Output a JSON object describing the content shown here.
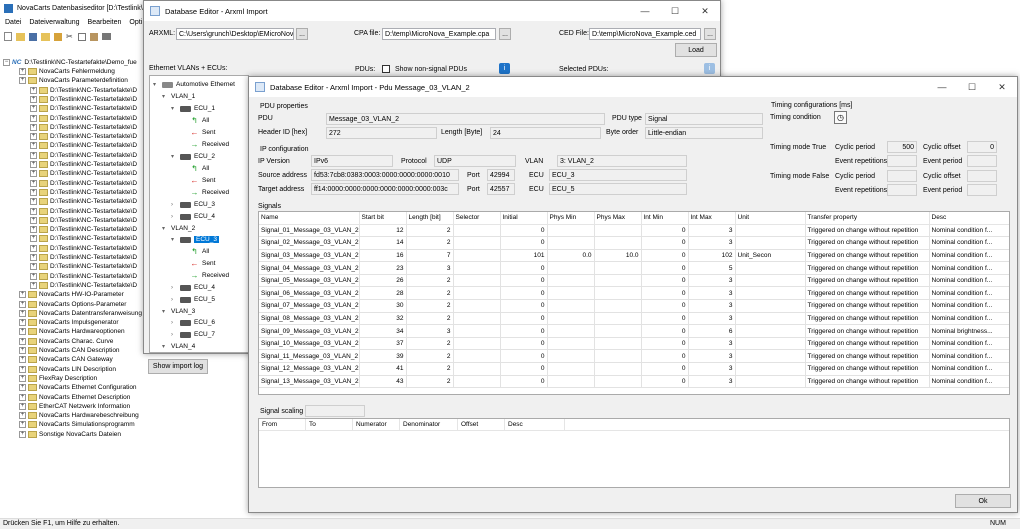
{
  "main_window": {
    "title": "NovaCarts Datenbasiseditor [D:\\Testlink\\",
    "menu": [
      "Datei",
      "Dateiverwaltung",
      "Bearbeiten",
      "Opti"
    ],
    "status": "Drücken Sie F1, um Hilfe zu erhalten.",
    "num": "NUM",
    "tree_root": "D:\\Testlink\\NC-Testartefakte\\Demo_fue",
    "tree_items": [
      "NovaCarts Fehlermeldung",
      "NovaCarts Parameterdefinition",
      "D:\\Testlink\\NC-Testartefakte\\D",
      "D:\\Testlink\\NC-Testartefakte\\D",
      "D:\\Testlink\\NC-Testartefakte\\D",
      "D:\\Testlink\\NC-Testartefakte\\D",
      "D:\\Testlink\\NC-Testartefakte\\D",
      "D:\\Testlink\\NC-Testartefakte\\D",
      "D:\\Testlink\\NC-Testartefakte\\D",
      "D:\\Testlink\\NC-Testartefakte\\D",
      "D:\\Testlink\\NC-Testartefakte\\D",
      "D:\\Testlink\\NC-Testartefakte\\D",
      "D:\\Testlink\\NC-Testartefakte\\D",
      "D:\\Testlink\\NC-Testartefakte\\D",
      "D:\\Testlink\\NC-Testartefakte\\D",
      "D:\\Testlink\\NC-Testartefakte\\D",
      "D:\\Testlink\\NC-Testartefakte\\D",
      "D:\\Testlink\\NC-Testartefakte\\D",
      "D:\\Testlink\\NC-Testartefakte\\D",
      "D:\\Testlink\\NC-Testartefakte\\D",
      "D:\\Testlink\\NC-Testartefakte\\D",
      "D:\\Testlink\\NC-Testartefakte\\D",
      "D:\\Testlink\\NC-Testartefakte\\D",
      "D:\\Testlink\\NC-Testartefakte\\D",
      "NovaCarts HW-IO-Parameter",
      "NovaCarts Options-Parameter",
      "NovaCarts Datentransferanweisung",
      "NovaCarts Impulsgenerator",
      "NovaCarts Hardwareoptionen",
      "NovaCarts Charac. Curve",
      "NovaCarts CAN Description",
      "NovaCarts CAN Gateway",
      "NovaCarts LIN Description",
      "FlexRay Description",
      "NovaCarts Ethernet Configuration",
      "NovaCarts Ethernet Description",
      "EtherCAT Netzwerk Information",
      "NovaCarts Hardwarebeschreibung",
      "NovaCarts Simulationsprogramm",
      "Sonstige NovaCarts Dateien"
    ]
  },
  "arxml_window": {
    "title": "Database Editor - Arxml Import",
    "arxml_label": "ARXML:",
    "arxml_value": "C:\\Users\\grunch\\Desktop\\EMicroNov",
    "cpa_label": "CPA file:",
    "cpa_value": "D:\\temp\\MicroNova_Example.cpa",
    "ced_label": "CED File:",
    "ced_value": "D:\\temp\\MicroNova_Example.ced",
    "browse": "...",
    "load": "Load",
    "pdus_label": "PDUs:",
    "non_signal_label": "Show non-signal PDUs",
    "selected_pdus_label": "Selected PDUs:",
    "eth_label": "Ethernet VLANs + ECUs:",
    "show_log": "Show import log",
    "tree": {
      "root": "Automotive Ethernet",
      "vlan1": "VLAN_1",
      "ecu1": "ECU_1",
      "all": "All",
      "sent": "Sent",
      "received": "Received",
      "ecu2": "ECU_2",
      "ecu3": "ECU_3",
      "ecu4": "ECU_4",
      "vlan2": "VLAN_2",
      "ecu5": "ECU_5",
      "vlan3": "VLAN_3",
      "ecu6": "ECU_6",
      "ecu7": "ECU_7",
      "vlan4": "VLAN_4"
    }
  },
  "pdu_window": {
    "title": "Database Editor - Arxml Import - Pdu Message_03_VLAN_2",
    "pdu_properties": "PDU properties",
    "pdu_label": "PDU",
    "pdu_value": "Message_03_VLAN_2",
    "pdu_type_label": "PDU type",
    "pdu_type_value": "Signal",
    "header_id_label": "Header ID [hex]",
    "header_id_value": "272",
    "length_label": "Length [Byte]",
    "length_value": "24",
    "byte_order_label": "Byte order",
    "byte_order_value": "Little-endian",
    "ip_config": "IP configuration",
    "ip_version_label": "IP Version",
    "ip_version_value": "IPv6",
    "protocol_label": "Protocol",
    "protocol_value": "UDP",
    "vlan_label": "VLAN",
    "vlan_value": "3: VLAN_2",
    "source_label": "Source address",
    "source_value": "fd53:7cb8:0383:0003:0000:0000:0000:0010",
    "port_label": "Port",
    "source_port": "42994",
    "ecu_label": "ECU",
    "source_ecu": "ECU_3",
    "target_label": "Target address",
    "target_value": "ff14:0000:0000:0000:0000:0000:0000:003c",
    "target_port": "42557",
    "target_ecu": "ECU_5",
    "timing_header": "Timing configurations [ms]",
    "timing_condition_label": "Timing condition",
    "mode_true_label": "Timing mode True",
    "mode_false_label": "Timing mode False",
    "cyclic_period_label": "Cyclic period",
    "cyclic_period_value": "500",
    "cyclic_offset_label": "Cyclic offset",
    "cyclic_offset_value": "0",
    "event_rep_label": "Event repetitions",
    "event_period_label": "Event period",
    "signals_label": "Signals",
    "columns": [
      "Name",
      "Start bit",
      "Length [bit]",
      "Selector",
      "Initial",
      "Phys Min",
      "Phys Max",
      "Int Min",
      "Int Max",
      "Unit",
      "Transfer property",
      "Desc"
    ],
    "rows": [
      [
        "Signal_01_Message_03_VLAN_2",
        "12",
        "2",
        "",
        "0",
        "",
        "",
        "0",
        "3",
        "",
        "Triggered on change without repetition",
        "Nominal condition f..."
      ],
      [
        "Signal_02_Message_03_VLAN_2",
        "14",
        "2",
        "",
        "0",
        "",
        "",
        "0",
        "3",
        "",
        "Triggered on change without repetition",
        "Nominal condition f..."
      ],
      [
        "Signal_03_Message_03_VLAN_2",
        "16",
        "7",
        "",
        "101",
        "0.0",
        "10.0",
        "0",
        "102",
        "Unit_Secon",
        "Triggered on change without repetition",
        "Nominal condition f..."
      ],
      [
        "Signal_04_Message_03_VLAN_2",
        "23",
        "3",
        "",
        "0",
        "",
        "",
        "0",
        "5",
        "",
        "Triggered on change without repetition",
        "Nominal condition f..."
      ],
      [
        "Signal_05_Message_03_VLAN_2",
        "26",
        "2",
        "",
        "0",
        "",
        "",
        "0",
        "3",
        "",
        "Triggered on change without repetition",
        "Nominal condition f..."
      ],
      [
        "Signal_06_Message_03_VLAN_2",
        "28",
        "2",
        "",
        "0",
        "",
        "",
        "0",
        "3",
        "",
        "Triggered on change without repetition",
        "Nominal condition f..."
      ],
      [
        "Signal_07_Message_03_VLAN_2",
        "30",
        "2",
        "",
        "0",
        "",
        "",
        "0",
        "3",
        "",
        "Triggered on change without repetition",
        "Nominal condition f..."
      ],
      [
        "Signal_08_Message_03_VLAN_2",
        "32",
        "2",
        "",
        "0",
        "",
        "",
        "0",
        "3",
        "",
        "Triggered on change without repetition",
        "Nominal condition f..."
      ],
      [
        "Signal_09_Message_03_VLAN_2",
        "34",
        "3",
        "",
        "0",
        "",
        "",
        "0",
        "6",
        "",
        "Triggered on change without repetition",
        "Nominal brightness..."
      ],
      [
        "Signal_10_Message_03_VLAN_2",
        "37",
        "2",
        "",
        "0",
        "",
        "",
        "0",
        "3",
        "",
        "Triggered on change without repetition",
        "Nominal condition f..."
      ],
      [
        "Signal_11_Message_03_VLAN_2",
        "39",
        "2",
        "",
        "0",
        "",
        "",
        "0",
        "3",
        "",
        "Triggered on change without repetition",
        "Nominal condition f..."
      ],
      [
        "Signal_12_Message_03_VLAN_2",
        "41",
        "2",
        "",
        "0",
        "",
        "",
        "0",
        "3",
        "",
        "Triggered on change without repetition",
        "Nominal condition f..."
      ],
      [
        "Signal_13_Message_03_VLAN_2",
        "43",
        "2",
        "",
        "0",
        "",
        "",
        "0",
        "3",
        "",
        "Triggered on change without repetition",
        "Nominal condition f..."
      ]
    ],
    "signal_scaling_label": "Signal scaling",
    "scaling_columns": [
      "From",
      "To",
      "Numerator",
      "Denominator",
      "Offset",
      "Desc"
    ],
    "ok": "Ok"
  },
  "colors": {
    "selection": "#0078d7",
    "arrow_green": "#1f9e2a",
    "arrow_red": "#d4201b"
  }
}
